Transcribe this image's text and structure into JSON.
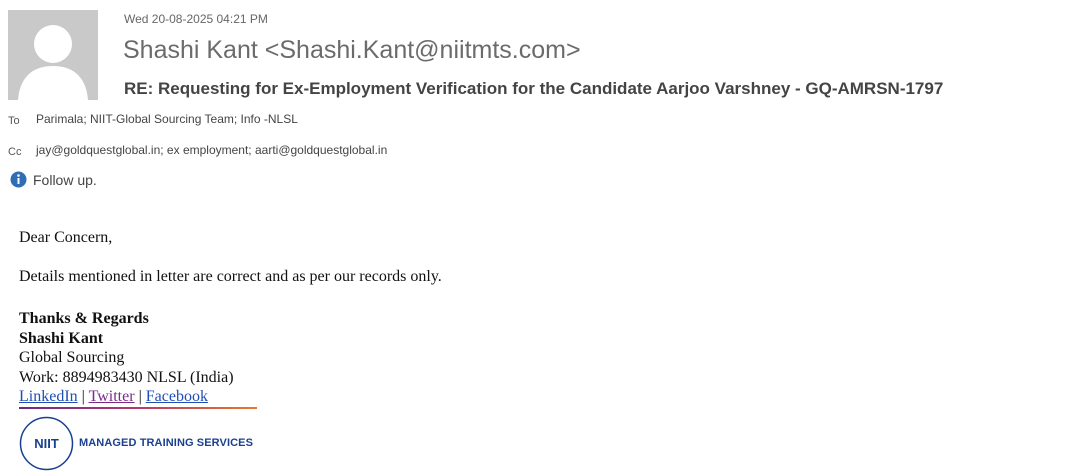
{
  "email": {
    "date": "Wed 20-08-2025 04:21 PM",
    "sender": "Shashi Kant <Shashi.Kant@niitmts.com>",
    "subject": "RE: Requesting for Ex-Employment Verification for the Candidate Aarjoo Varshney - GQ-AMRSN-1797",
    "to_label": "To",
    "to_value": "Parimala; NIIT-Global Sourcing Team; Info -NLSL",
    "cc_label": "Cc",
    "cc_value": "jay@goldquestglobal.in; ex employment; aarti@goldquestglobal.in",
    "flag_text": "Follow up."
  },
  "body": {
    "greeting": "Dear Concern,",
    "message": "Details mentioned in letter are correct and as per our records only."
  },
  "signature": {
    "regards": "Thanks & Regards",
    "name": "Shashi Kant",
    "department": "Global Sourcing",
    "work": "Work: 8894983430 NLSL (India)",
    "link_linkedin": "LinkedIn",
    "link_twitter": "Twitter",
    "link_facebook": "Facebook",
    "sep1": " | ",
    "sep2": " | ",
    "logo_mark": "NIIT",
    "logo_text": "MANAGED TRAINING SERVICES"
  },
  "colors": {
    "link_blue": "#1f4fb5",
    "link_visited": "#7b2a8b",
    "logo_blue": "#1b3f8f"
  },
  "icons": [
    "person-avatar-icon",
    "info-icon"
  ]
}
